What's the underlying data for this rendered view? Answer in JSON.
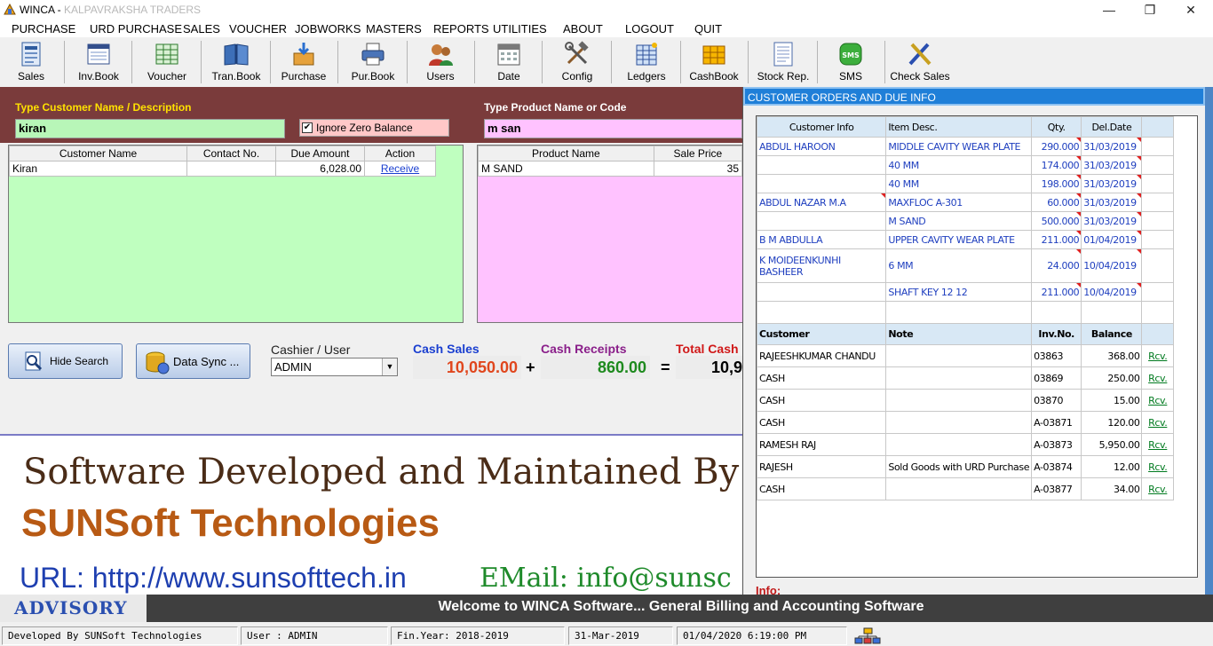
{
  "titlebar": {
    "app": "WINCA - ",
    "company": "KALPAVRAKSHA TRADERS",
    "minimize": "—",
    "restore": "❐",
    "close": "✕"
  },
  "menu": [
    "PURCHASE",
    "URD PURCHASE",
    "SALES",
    "VOUCHER",
    "JOBWORKS",
    "MASTERS",
    "REPORTS",
    "UTILITIES",
    "ABOUT",
    "LOGOUT",
    "QUIT"
  ],
  "toolbar": [
    {
      "label": "Sales",
      "icon": "sales-icon"
    },
    {
      "label": "Inv.Book",
      "icon": "invoice-book-icon"
    },
    {
      "label": "Voucher",
      "icon": "voucher-icon"
    },
    {
      "label": "Tran.Book",
      "icon": "transaction-book-icon"
    },
    {
      "label": "Purchase",
      "icon": "purchase-icon"
    },
    {
      "label": "Pur.Book",
      "icon": "printer-icon"
    },
    {
      "label": "Users",
      "icon": "users-icon"
    },
    {
      "label": "Date",
      "icon": "calendar-icon"
    },
    {
      "label": "Config",
      "icon": "tools-icon"
    },
    {
      "label": "Ledgers",
      "icon": "ledger-icon"
    },
    {
      "label": "CashBook",
      "icon": "cashbook-icon"
    },
    {
      "label": "Stock Rep.",
      "icon": "stock-report-icon"
    },
    {
      "label": "SMS",
      "icon": "sms-icon"
    },
    {
      "label": "Check Sales",
      "icon": "check-sales-icon"
    }
  ],
  "customer_search": {
    "label": "Type Customer Name / Description",
    "value": "kiran",
    "ignore_zero_label": "Ignore Zero Balance",
    "ignore_zero_checked": true,
    "columns": [
      "Customer Name",
      "Contact No.",
      "Due Amount",
      "Action"
    ],
    "rows": [
      {
        "name": "Kiran",
        "contact": "",
        "due": "6,028.00",
        "action": "Receive"
      }
    ]
  },
  "product_search": {
    "label": "Type Product Name or Code",
    "value": "m san",
    "columns": [
      "Product Name",
      "Sale Price"
    ],
    "rows": [
      {
        "name": "M SAND",
        "price": "35"
      }
    ]
  },
  "actions": {
    "hide_search": "Hide Search",
    "data_sync": "Data Sync ..."
  },
  "cashier": {
    "label": "Cashier / User",
    "value": "ADMIN"
  },
  "totals": {
    "cash_sales_label": "Cash Sales",
    "cash_sales": "10,050.00",
    "plus": "+",
    "cash_receipts_label": "Cash Receipts",
    "cash_receipts": "860.00",
    "equals": "=",
    "total_cash_label": "Total Cash",
    "total_cash": "10,9"
  },
  "banner": {
    "line1": "Software Developed and Maintained By",
    "company": "SUNSoft Technologies",
    "url": "URL: http://www.sunsofttech.in",
    "email": "EMail: info@sunsc"
  },
  "orders": {
    "title": "CUSTOMER ORDERS AND DUE INFO",
    "columns": [
      "Customer Info",
      "Item Desc.",
      "Qty.",
      "Del.Date"
    ],
    "rows": [
      {
        "customer": "ABDUL HAROON",
        "item": "MIDDLE CAVITY WEAR PLATE",
        "qty": "290.000",
        "date": "31/03/2019"
      },
      {
        "customer": "",
        "item": "40 MM",
        "qty": "174.000",
        "date": "31/03/2019"
      },
      {
        "customer": "",
        "item": "40 MM",
        "qty": "198.000",
        "date": "31/03/2019"
      },
      {
        "customer": "ABDUL NAZAR M.A",
        "item": "MAXFLOC A-301",
        "qty": "60.000",
        "date": "31/03/2019"
      },
      {
        "customer": "",
        "item": "M SAND",
        "qty": "500.000",
        "date": "31/03/2019"
      },
      {
        "customer": "B M ABDULLA",
        "item": "UPPER CAVITY WEAR PLATE",
        "qty": "211.000",
        "date": "01/04/2019"
      },
      {
        "customer": "K MOIDEENKUNHI BASHEER",
        "item": "6 MM",
        "qty": "24.000",
        "date": "10/04/2019"
      },
      {
        "customer": "",
        "item": "SHAFT KEY 12  12",
        "qty": "211.000",
        "date": "10/04/2019"
      }
    ]
  },
  "dues": {
    "columns": [
      "Customer",
      "Note",
      "Inv.No.",
      "Balance"
    ],
    "rows": [
      {
        "customer": "RAJEESHKUMAR CHANDU",
        "note": "",
        "inv": "03863",
        "balance": "368.00",
        "action": "Rcv."
      },
      {
        "customer": "CASH",
        "note": "",
        "inv": "03869",
        "balance": "250.00",
        "action": "Rcv."
      },
      {
        "customer": "CASH",
        "note": "",
        "inv": "03870",
        "balance": "15.00",
        "action": "Rcv."
      },
      {
        "customer": "CASH",
        "note": "",
        "inv": "A-03871",
        "balance": "120.00",
        "action": "Rcv."
      },
      {
        "customer": "RAMESH RAJ",
        "note": "",
        "inv": "A-03873",
        "balance": "5,950.00",
        "action": "Rcv."
      },
      {
        "customer": "RAJESH",
        "note": "Sold Goods with URD Purchase",
        "inv": "A-03874",
        "balance": "12.00",
        "action": "Rcv."
      },
      {
        "customer": "CASH",
        "note": "",
        "inv": "A-03877",
        "balance": "34.00",
        "action": "Rcv."
      }
    ],
    "info_label": "Info:"
  },
  "advisory": {
    "badge": "ADVISORY",
    "message": "Welcome to WINCA Software... General Billing and Accounting Software"
  },
  "status": {
    "developer": "Developed By SUNSoft Technologies",
    "user": "User : ADMIN",
    "fin_year": "Fin.Year: 2018-2019",
    "date": "31-Mar-2019",
    "datetime": "01/04/2020 6:19:00 PM"
  }
}
